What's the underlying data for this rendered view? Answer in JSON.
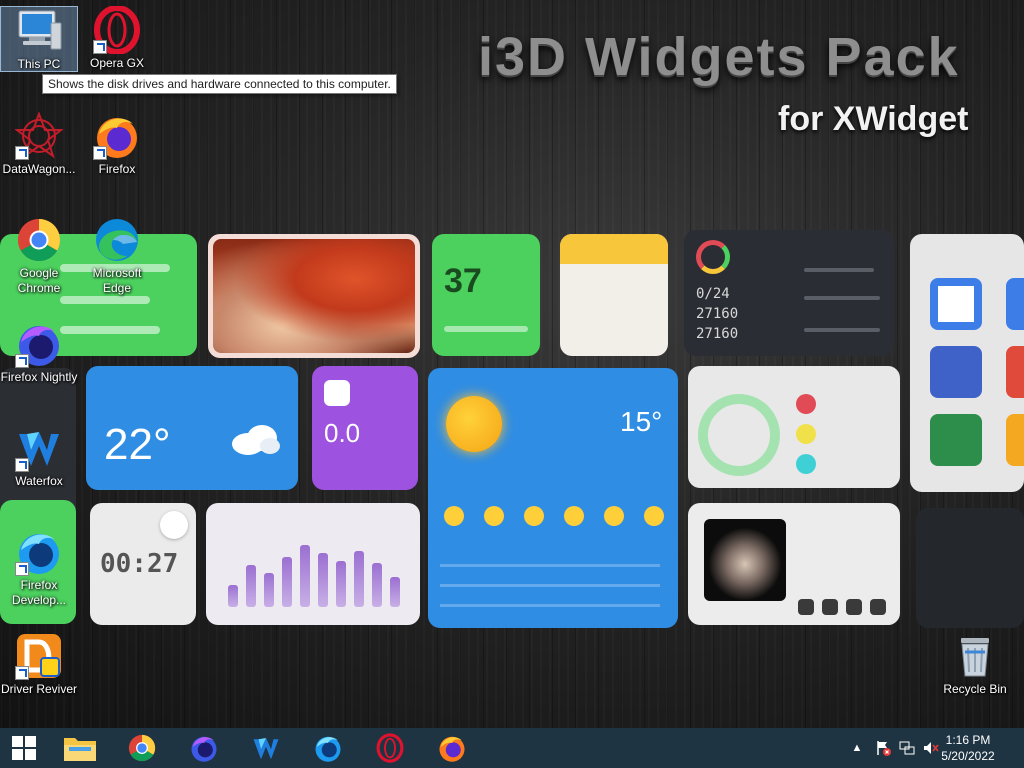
{
  "wallpaper": {
    "title": "i3D Widgets Pack",
    "subtitle": "for XWidget",
    "widget_values": {
      "steps": "37",
      "weather_temp": "22°",
      "purple_value": "0.0",
      "forecast_temp": "15°",
      "clock_time": "00:27",
      "dark_lines": [
        "0/24",
        "27160",
        "27160"
      ]
    }
  },
  "desktop_icons": [
    {
      "label": "This PC",
      "icon": "this-pc-icon"
    },
    {
      "label": "Opera GX",
      "icon": "opera-gx-icon"
    },
    {
      "label": "DataWagon...",
      "icon": "datawagon-icon"
    },
    {
      "label": "Firefox",
      "icon": "firefox-icon"
    },
    {
      "label": "Google Chrome",
      "icon": "chrome-icon"
    },
    {
      "label": "Microsoft Edge",
      "icon": "edge-icon"
    },
    {
      "label": "Firefox Nightly",
      "icon": "firefox-nightly-icon"
    },
    {
      "label": "Waterfox",
      "icon": "waterfox-icon"
    },
    {
      "label": "Firefox Develop...",
      "icon": "firefox-developer-icon"
    },
    {
      "label": "Driver Reviver",
      "icon": "driver-reviver-icon"
    },
    {
      "label": "Recycle Bin",
      "icon": "recycle-bin-icon"
    }
  ],
  "tooltip": "Shows the disk drives and hardware connected to this computer.",
  "taskbar": {
    "items": [
      "start",
      "file-explorer",
      "chrome",
      "firefox-nightly",
      "waterfox",
      "firefox-developer",
      "opera-gx",
      "firefox"
    ],
    "clock": {
      "time": "1:16 PM",
      "date": "5/20/2022"
    },
    "tray": [
      "show-hidden-icons",
      "action-center-flag",
      "network",
      "volume-muted"
    ]
  },
  "colors": {
    "taskbar": "#1f3443",
    "widget_green": "#4cd05e",
    "widget_blue": "#2f8de4",
    "widget_purple": "#9d52e0"
  }
}
